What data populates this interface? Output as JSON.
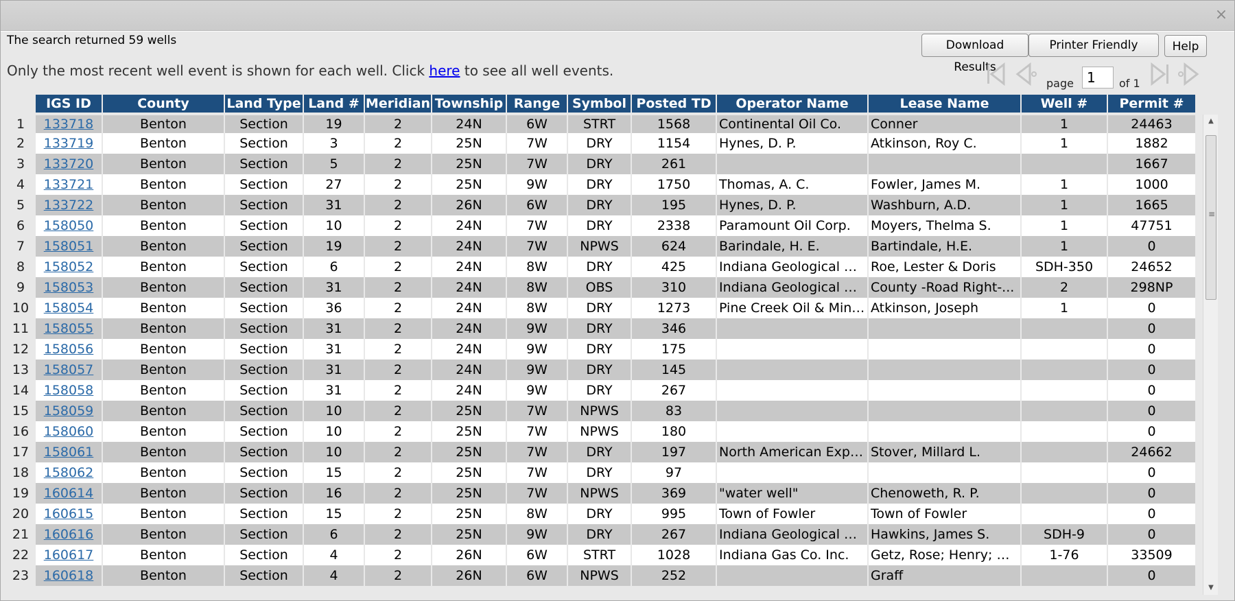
{
  "dialog": {
    "close_glyph": "×"
  },
  "summary": "The search returned 59 wells",
  "note": {
    "before": "Only the most recent well event is shown for each well. Click ",
    "link": "here",
    "after": " to see all well events."
  },
  "buttons": {
    "download": "Download Results",
    "printer": "Printer Friendly",
    "help": "Help"
  },
  "pager": {
    "page_label": "page",
    "page_value": "1",
    "of_label": "of 1"
  },
  "columns": [
    "IGS ID",
    "County",
    "Land Type",
    "Land #",
    "Meridian",
    "Township",
    "Range",
    "Symbol",
    "Posted TD",
    "Operator Name",
    "Lease Name",
    "Well #",
    "Permit #"
  ],
  "rows": [
    [
      "1",
      "133718",
      "Benton",
      "Section",
      "19",
      "2",
      "24N",
      "6W",
      "STRT",
      "1568",
      "Continental Oil Co.",
      "Conner",
      "1",
      "24463"
    ],
    [
      "2",
      "133719",
      "Benton",
      "Section",
      "3",
      "2",
      "25N",
      "7W",
      "DRY",
      "1154",
      "Hynes, D. P.",
      "Atkinson, Roy C.",
      "1",
      "1882"
    ],
    [
      "3",
      "133720",
      "Benton",
      "Section",
      "5",
      "2",
      "25N",
      "7W",
      "DRY",
      "261",
      "",
      "",
      "",
      "1667"
    ],
    [
      "4",
      "133721",
      "Benton",
      "Section",
      "27",
      "2",
      "25N",
      "9W",
      "DRY",
      "1750",
      "Thomas, A. C.",
      "Fowler, James M.",
      "1",
      "1000"
    ],
    [
      "5",
      "133722",
      "Benton",
      "Section",
      "31",
      "2",
      "26N",
      "6W",
      "DRY",
      "195",
      "Hynes, D. P.",
      "Washburn, A.D.",
      "1",
      "1665"
    ],
    [
      "6",
      "158050",
      "Benton",
      "Section",
      "10",
      "2",
      "24N",
      "7W",
      "DRY",
      "2338",
      "Paramount Oil Corp.",
      "Moyers, Thelma S.",
      "1",
      "47751"
    ],
    [
      "7",
      "158051",
      "Benton",
      "Section",
      "19",
      "2",
      "24N",
      "7W",
      "NPWS",
      "624",
      "Barindale, H. E.",
      "Bartindale, H.E.",
      "1",
      "0"
    ],
    [
      "8",
      "158052",
      "Benton",
      "Section",
      "6",
      "2",
      "24N",
      "8W",
      "DRY",
      "425",
      "Indiana Geological Su...",
      "Roe, Lester & Doris",
      "SDH-350",
      "24652"
    ],
    [
      "9",
      "158053",
      "Benton",
      "Section",
      "31",
      "2",
      "24N",
      "8W",
      "OBS",
      "310",
      "Indiana Geological Su...",
      "County -Road Right-...",
      "2",
      "298NP"
    ],
    [
      "10",
      "158054",
      "Benton",
      "Section",
      "36",
      "2",
      "24N",
      "8W",
      "DRY",
      "1273",
      "Pine Creek Oil & Mini...",
      "Atkinson, Joseph",
      "1",
      "0"
    ],
    [
      "11",
      "158055",
      "Benton",
      "Section",
      "31",
      "2",
      "24N",
      "9W",
      "DRY",
      "346",
      "",
      "",
      "",
      "0"
    ],
    [
      "12",
      "158056",
      "Benton",
      "Section",
      "31",
      "2",
      "24N",
      "9W",
      "DRY",
      "175",
      "",
      "",
      "",
      "0"
    ],
    [
      "13",
      "158057",
      "Benton",
      "Section",
      "31",
      "2",
      "24N",
      "9W",
      "DRY",
      "145",
      "",
      "",
      "",
      "0"
    ],
    [
      "14",
      "158058",
      "Benton",
      "Section",
      "31",
      "2",
      "24N",
      "9W",
      "DRY",
      "267",
      "",
      "",
      "",
      "0"
    ],
    [
      "15",
      "158059",
      "Benton",
      "Section",
      "10",
      "2",
      "25N",
      "7W",
      "NPWS",
      "83",
      "",
      "",
      "",
      "0"
    ],
    [
      "16",
      "158060",
      "Benton",
      "Section",
      "10",
      "2",
      "25N",
      "7W",
      "NPWS",
      "180",
      "",
      "",
      "",
      "0"
    ],
    [
      "17",
      "158061",
      "Benton",
      "Section",
      "10",
      "2",
      "25N",
      "7W",
      "DRY",
      "197",
      "North American Explo...",
      "Stover, Millard L.",
      "",
      "24662"
    ],
    [
      "18",
      "158062",
      "Benton",
      "Section",
      "15",
      "2",
      "25N",
      "7W",
      "DRY",
      "97",
      "",
      "",
      "",
      "0"
    ],
    [
      "19",
      "160614",
      "Benton",
      "Section",
      "16",
      "2",
      "25N",
      "7W",
      "NPWS",
      "369",
      "\"water well\"",
      "Chenoweth, R. P.",
      "",
      "0"
    ],
    [
      "20",
      "160615",
      "Benton",
      "Section",
      "15",
      "2",
      "25N",
      "8W",
      "DRY",
      "995",
      "Town of Fowler",
      "Town of Fowler",
      "",
      "0"
    ],
    [
      "21",
      "160616",
      "Benton",
      "Section",
      "6",
      "2",
      "25N",
      "9W",
      "DRY",
      "267",
      "Indiana Geological Su...",
      "Hawkins, James S.",
      "SDH-9",
      "0"
    ],
    [
      "22",
      "160617",
      "Benton",
      "Section",
      "4",
      "2",
      "26N",
      "6W",
      "STRT",
      "1028",
      "Indiana Gas Co. Inc.",
      "Getz, Rose; Henry; &...",
      "1-76",
      "33509"
    ],
    [
      "23",
      "160618",
      "Benton",
      "Section",
      "4",
      "2",
      "26N",
      "6W",
      "NPWS",
      "252",
      "",
      "Graff",
      "",
      "0"
    ]
  ],
  "colors": {
    "header_bg": "#1d4e7f",
    "row_alt": "#c8c8c8",
    "link": "#2b6aa8"
  },
  "icons": {
    "first": "first-page-icon",
    "prev": "prev-page-icon",
    "next": "next-page-icon",
    "last": "last-page-icon"
  }
}
